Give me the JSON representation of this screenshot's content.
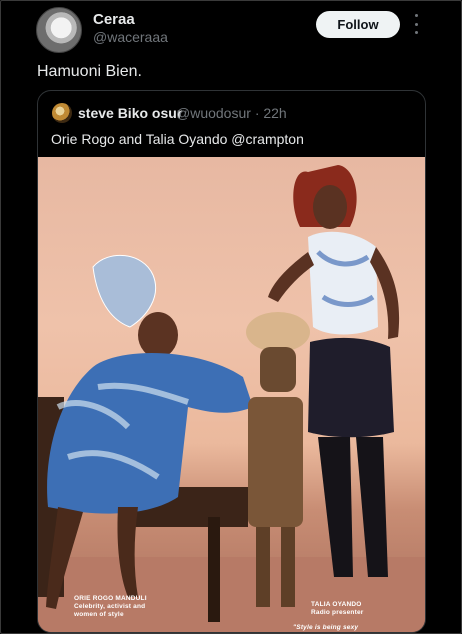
{
  "post": {
    "author_name": "Ceraa",
    "author_handle": "@waceraaa",
    "follow_label": "Follow",
    "text": "Hamuoni Bien."
  },
  "quoted": {
    "author_name": "steve Biko osur",
    "author_handle": "@wuodosur",
    "time": "· 22h",
    "text": "Orie Rogo and Talia Oyando @crampton",
    "photo": {
      "caption_left_name": "ORIE ROGO MANDULI",
      "caption_left_line1": "Celebrity, activist and",
      "caption_left_line2": "women of style",
      "caption_right_name": "TALIA OYANDO",
      "caption_right_role": "Radio presenter",
      "caption_bottom": "\"Style is being sexy"
    }
  },
  "icons": {
    "more": "more-vertical-icon"
  },
  "colors": {
    "background": "#000000",
    "text": "#e7e9ea",
    "muted": "#71767b",
    "follow_bg": "#eff3f4"
  }
}
